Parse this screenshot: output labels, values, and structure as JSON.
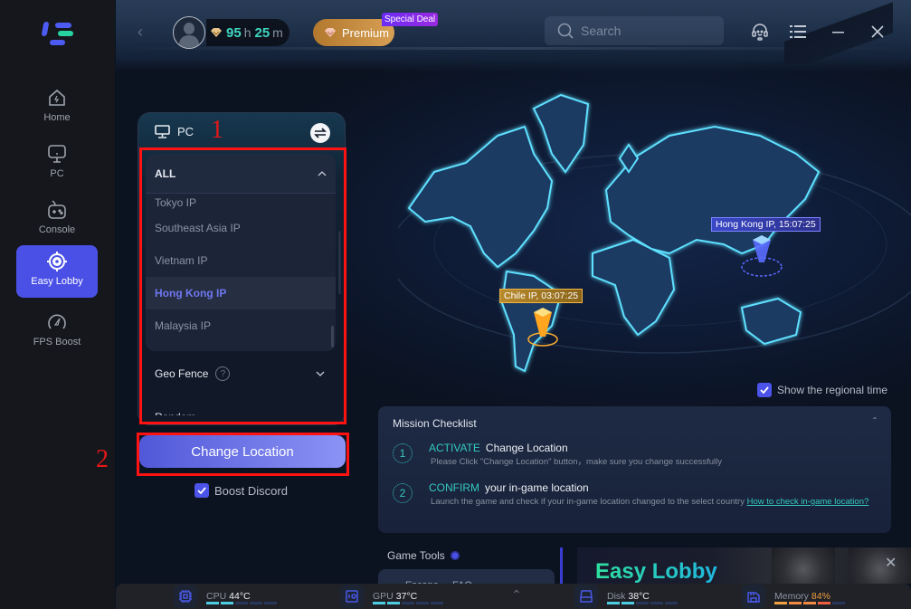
{
  "sidebar": {
    "items": [
      {
        "label": "Home",
        "icon": "home-icon"
      },
      {
        "label": "PC",
        "icon": "monitor-icon"
      },
      {
        "label": "Console",
        "icon": "gamepad-icon"
      },
      {
        "label": "Easy Lobby",
        "icon": "target-icon",
        "active": true
      },
      {
        "label": "FPS Boost",
        "icon": "speedometer-icon"
      }
    ]
  },
  "header": {
    "time_hours": "95",
    "time_hours_unit": "h",
    "time_minutes": "25",
    "time_minutes_unit": "m",
    "premium_label": "Premium",
    "deal_badge": "Special Deal",
    "search_placeholder": "Search"
  },
  "panel": {
    "platform": "PC",
    "dropdown": {
      "header": "ALL",
      "items": [
        "Tokyo IP",
        "Southeast Asia IP",
        "Vietnam IP",
        "Hong Kong IP",
        "Malaysia IP"
      ],
      "selected": "Hong Kong IP"
    },
    "geo_fence_label": "Geo Fence",
    "geo_fence_help": "?",
    "random_label": "Random",
    "change_location_label": "Change Location",
    "boost_discord_label": "Boost Discord",
    "boost_discord_checked": true
  },
  "annotations": {
    "one": "1",
    "two": "2"
  },
  "map": {
    "markers": [
      {
        "label": "Hong Kong IP, 15:07:25",
        "color": "#4a55e0"
      },
      {
        "label": "Chile IP, 03:07:25",
        "color": "#e8a530"
      }
    ],
    "show_regional_time_label": "Show the regional time",
    "show_regional_time_checked": true
  },
  "mission": {
    "title": "Mission Checklist",
    "steps": [
      {
        "num": "1",
        "keyword": "ACTIVATE",
        "title": "Change Location",
        "desc": "Please Click \"Change Location\" button，make sure you change successfully",
        "link": ""
      },
      {
        "num": "2",
        "keyword": "CONFIRM",
        "title": "your in-game location",
        "desc": "Launch the game and check if your in-game location changed to the select country ",
        "link": "How to check in-game location?"
      }
    ]
  },
  "game_tools": {
    "title": "Game Tools",
    "card_text": "Escape ... FAQ"
  },
  "banner": {
    "title": "Easy Lobby"
  },
  "status": {
    "cpu": {
      "label": "CPU",
      "value": "44°C",
      "level": 0.4
    },
    "gpu": {
      "label": "GPU",
      "value": "37°C",
      "level": 0.4
    },
    "disk": {
      "label": "Disk",
      "value": "38°C",
      "level": 0.4
    },
    "memory": {
      "label": "Memory",
      "value": "84%",
      "level": 0.84
    }
  },
  "colors": {
    "accent": "#4a50e6",
    "teal": "#35c9c0",
    "premium": "#d8a054",
    "annotation_red": "#ff1212"
  }
}
